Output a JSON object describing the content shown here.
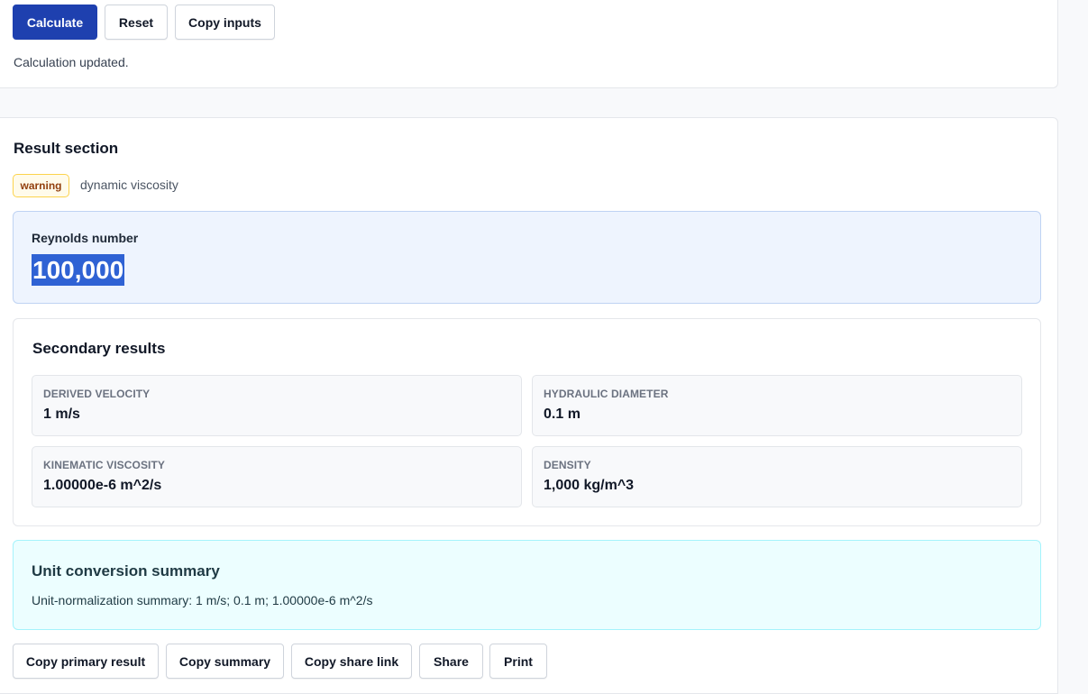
{
  "toolbar": {
    "calculate_label": "Calculate",
    "reset_label": "Reset",
    "copy_inputs_label": "Copy inputs"
  },
  "status": {
    "message": "Calculation updated."
  },
  "result": {
    "title": "Result section",
    "badge": "warning",
    "badge_note": "dynamic viscosity",
    "primary": {
      "label": "Reynolds number",
      "value": "100,000"
    },
    "secondary": {
      "title": "Secondary results",
      "items": [
        {
          "label": "DERIVED VELOCITY",
          "value": "1 m/s"
        },
        {
          "label": "HYDRAULIC DIAMETER",
          "value": "0.1 m"
        },
        {
          "label": "KINEMATIC VISCOSITY",
          "value": "1.00000e-6 m^2/s"
        },
        {
          "label": "DENSITY",
          "value": "1,000 kg/m^3"
        }
      ]
    },
    "summary": {
      "title": "Unit conversion summary",
      "text": "Unit-normalization summary: 1 m/s; 0.1 m; 1.00000e-6 m^2/s"
    }
  },
  "actions": {
    "copy_primary_label": "Copy primary result",
    "copy_summary_label": "Copy summary",
    "copy_share_link_label": "Copy share link",
    "share_label": "Share",
    "print_label": "Print"
  },
  "colors": {
    "primary_button": "#1e40af",
    "highlight": "#2f62d4",
    "warning_badge_bg": "#fffbeb",
    "warning_badge_border": "#fcd34d",
    "primary_box_bg": "#eef4fe",
    "summary_box_bg": "#ecfeff"
  }
}
